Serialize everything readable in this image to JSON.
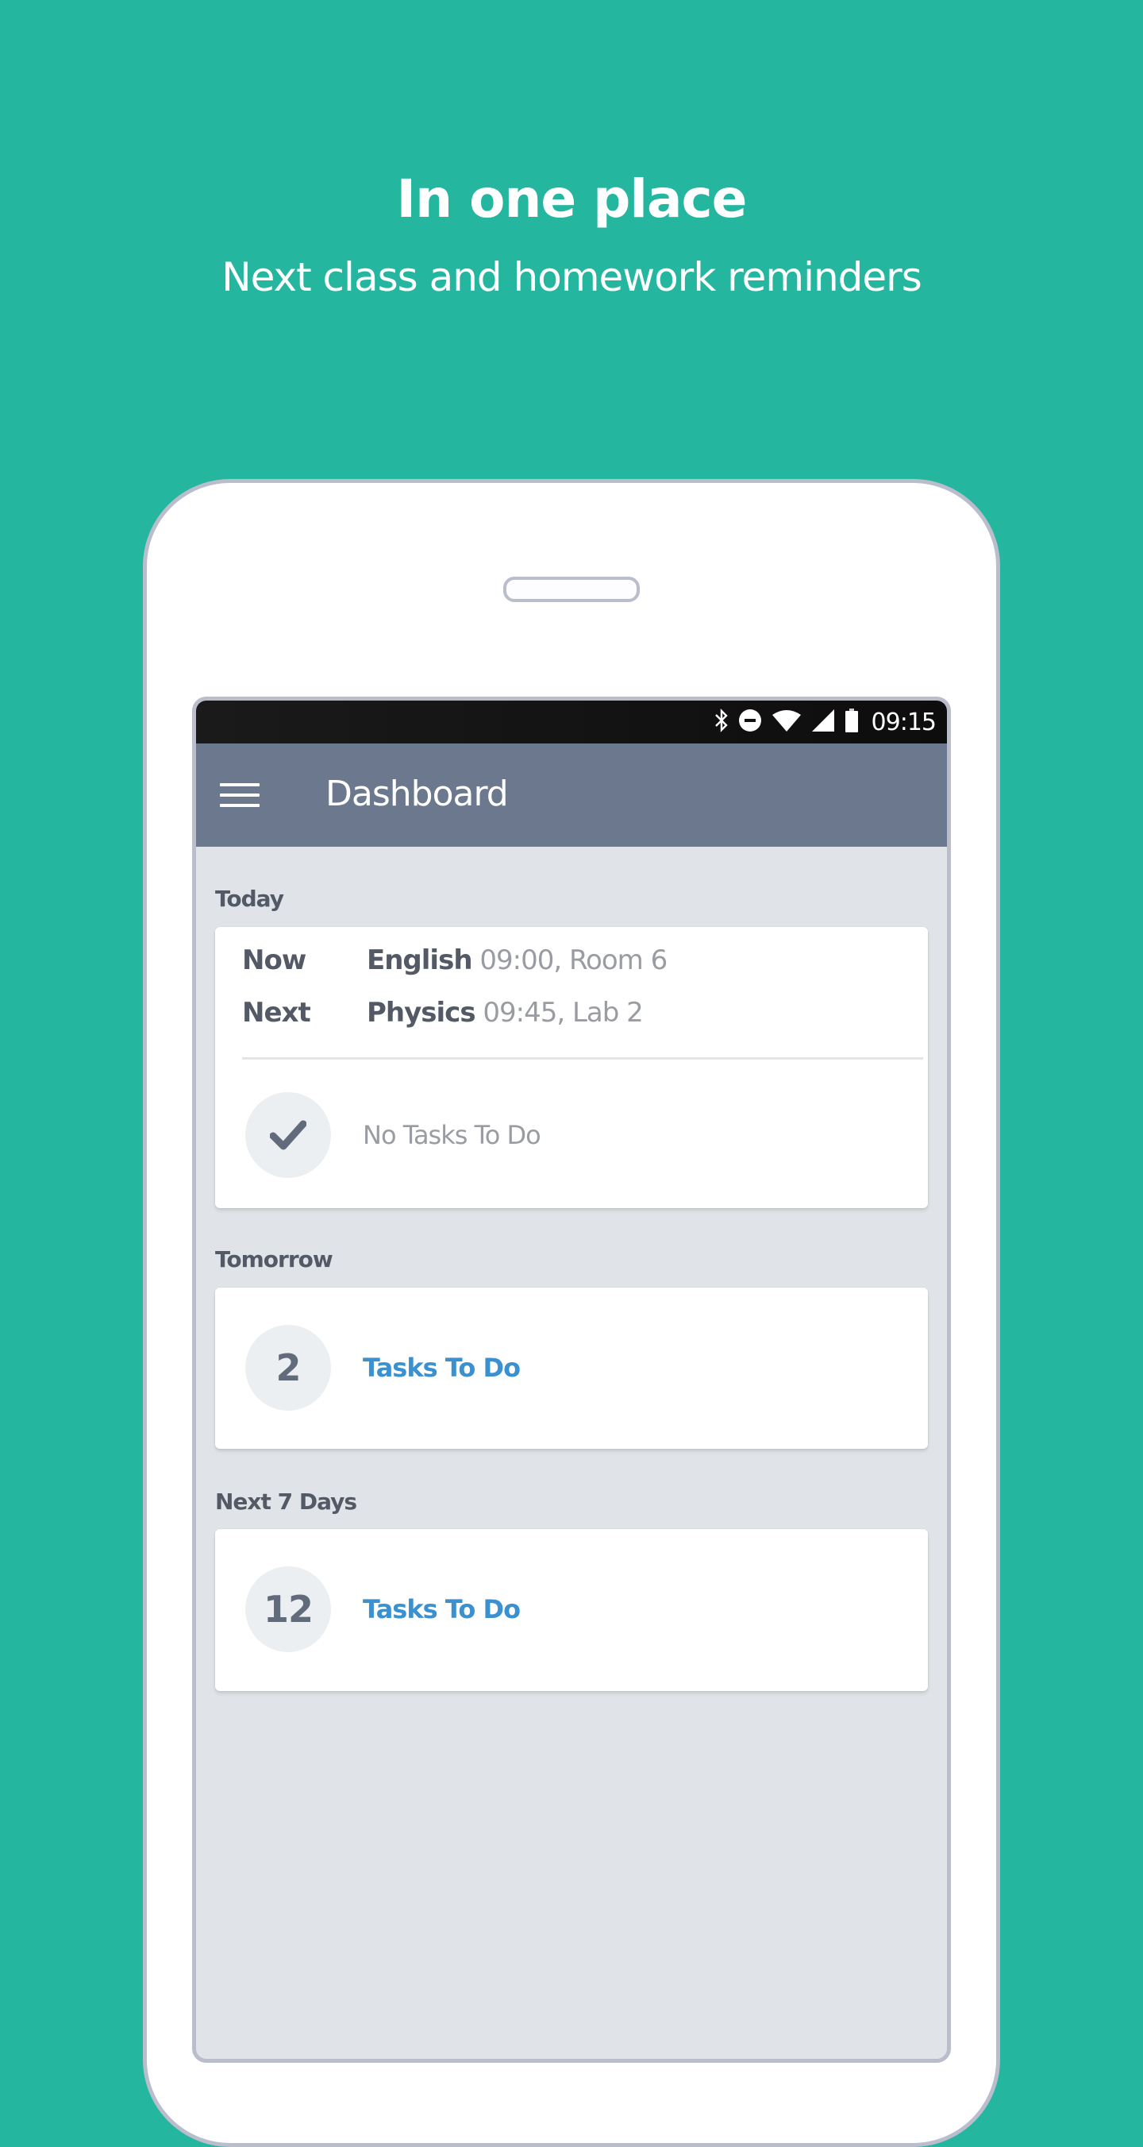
{
  "promo": {
    "headline": "In one place",
    "subheadline": "Next class and homework reminders"
  },
  "status_bar": {
    "icons": [
      "bluetooth-icon",
      "do-not-disturb-icon",
      "wifi-icon",
      "cellular-signal-icon",
      "battery-icon"
    ],
    "time": "09:15"
  },
  "toolbar": {
    "menu_icon": "hamburger-menu-icon",
    "title": "Dashboard"
  },
  "sections": {
    "today": {
      "label": "Today",
      "classes": [
        {
          "kind": "Now",
          "subject": "English",
          "detail": "09:00, Room 6"
        },
        {
          "kind": "Next",
          "subject": "Physics",
          "detail": "09:45, Lab 2"
        }
      ],
      "tasks": {
        "icon": "checkmark-icon",
        "text": "No Tasks To Do"
      }
    },
    "tomorrow": {
      "label": "Tomorrow",
      "tasks": {
        "count": "2",
        "text": "Tasks To Do"
      }
    },
    "next7": {
      "label": "Next 7 Days",
      "tasks": {
        "count": "12",
        "text": "Tasks To Do"
      }
    }
  },
  "colors": {
    "background": "#25b6a0",
    "toolbar": "#6c788d",
    "screen_bg": "#e0e4e8",
    "link": "#3b91cf",
    "phone_frame": "#b9bdcc"
  }
}
